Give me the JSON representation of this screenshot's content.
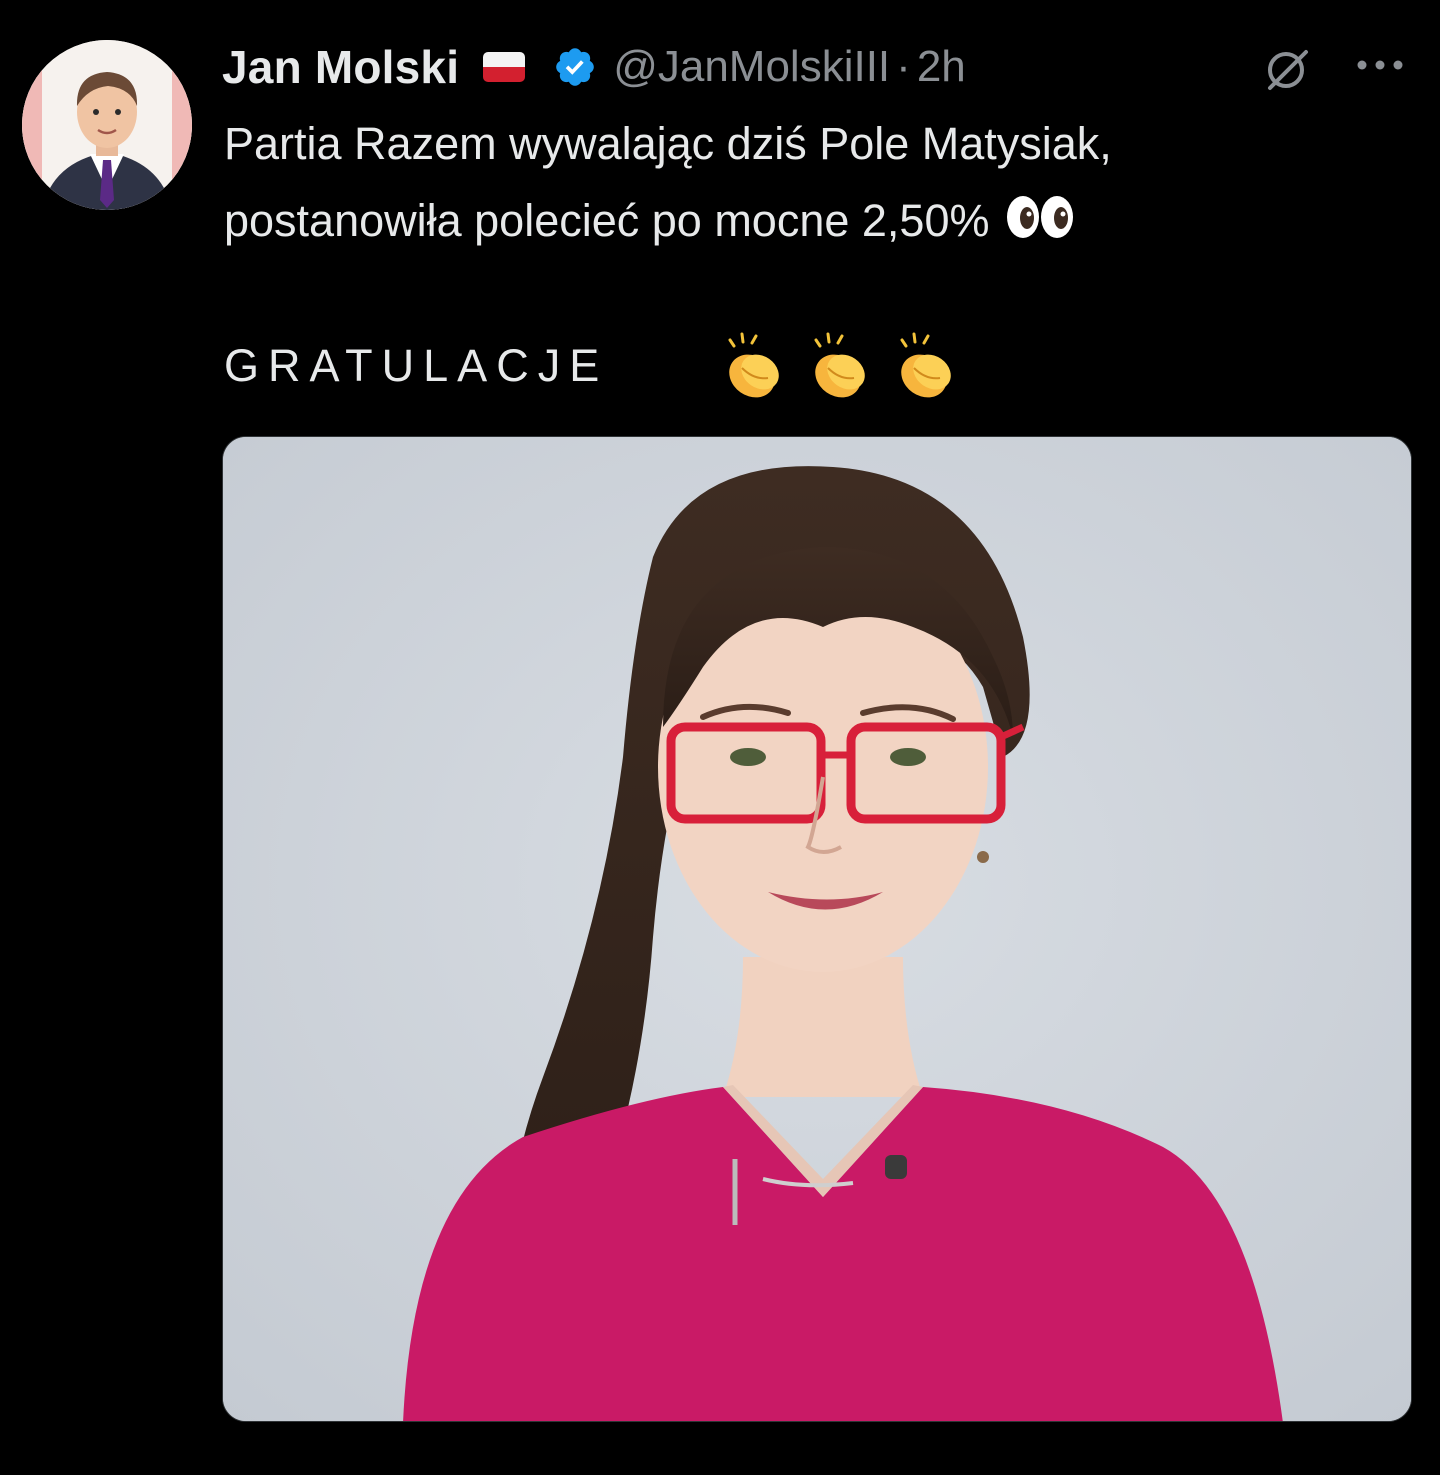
{
  "tweet": {
    "author_name": "Jan Molski",
    "author_flag": "flag-poland-icon",
    "handle": "@JanMolskiIII",
    "separator": "·",
    "time": "2h",
    "text_line_1": "Partia Razem wywalając dziś Pole Matysiak,",
    "text_line_2": "postanowiła polecieć po mocne 2,50%",
    "text_line_2_emoji": "eyes-icon",
    "text_line_3": "GRATULACJE",
    "text_line_3_emoji": [
      "clapping-hands-icon",
      "clapping-hands-icon",
      "clapping-hands-icon"
    ],
    "media": "photo-portrait"
  },
  "colors": {
    "background": "#000000",
    "text": "#e7e9ea",
    "secondary_text": "#8b8f94",
    "verified_badge": "#1d9bf0"
  }
}
